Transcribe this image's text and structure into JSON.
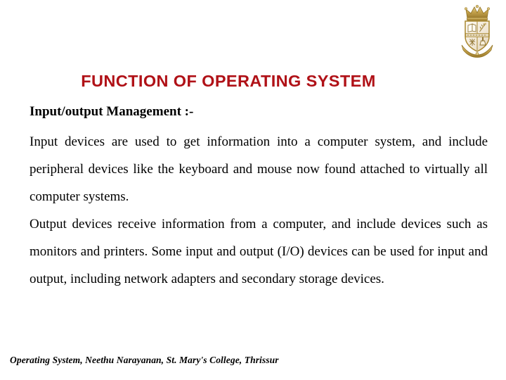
{
  "slide": {
    "background_color": "#ffffff",
    "title": "FUNCTION OF OPERATING SYSTEM",
    "title_color": "#b01117",
    "subheading": "Input/output Management :-",
    "paragraphs": [
      "Input devices are used to get information into a computer system, and include peripheral devices like the keyboard and mouse now found attached to virtually all computer systems.",
      "Output devices receive information from a computer, and include devices such as monitors and printers. Some input and output (I/O) devices can be used for input and output, including network adapters and secondary storage devices."
    ],
    "footer": "Operating System, Neethu Narayanan, St. Mary's College, Thrissur",
    "logo": {
      "name": "college-crest-logo",
      "description": "St. Mary's College coat of arms with gold crown, quartered shield and ribbon banner",
      "crown_color": "#c8a24a",
      "shield_color": "#f3ece0",
      "outline_color": "#a8872f",
      "ribbon_color": "#c2a04c"
    }
  }
}
